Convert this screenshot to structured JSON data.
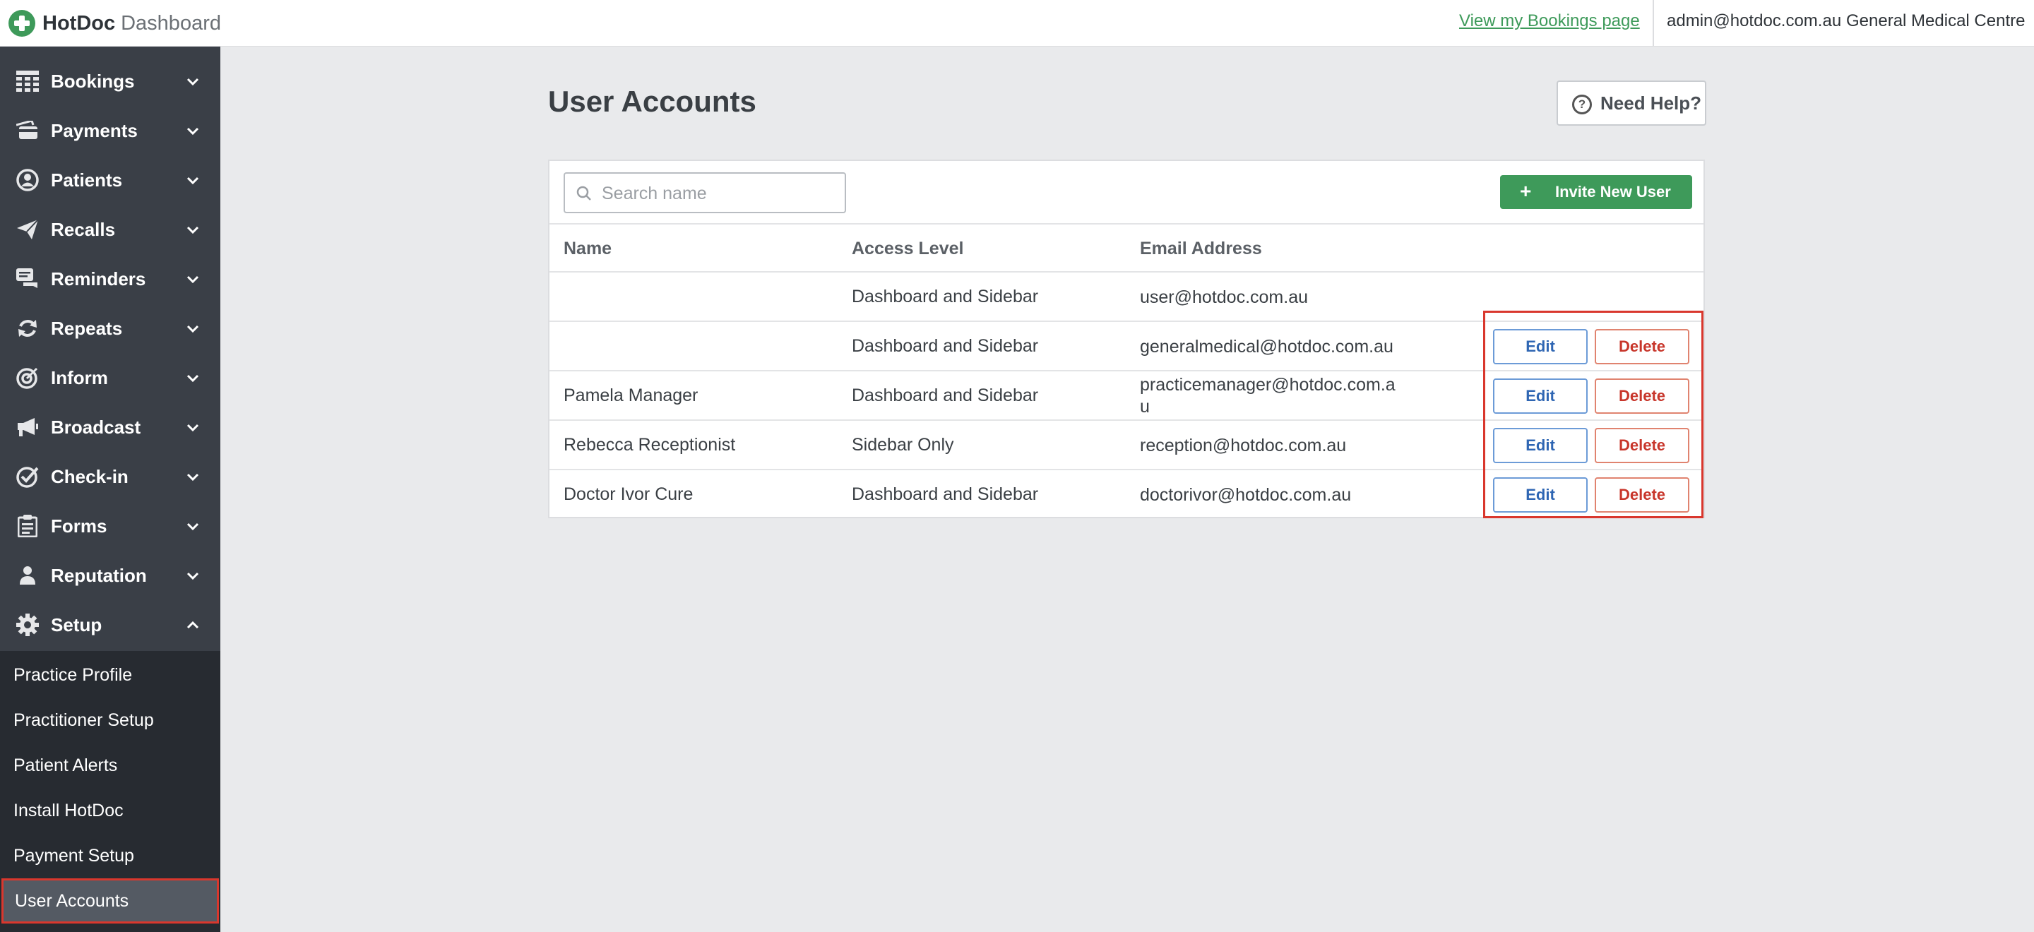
{
  "header": {
    "brand_name": "HotDoc",
    "brand_sub": "Dashboard",
    "bookings_link": "View my Bookings page",
    "user_email": "admin@hotdoc.com.au",
    "practice_name": "General Medical Centre",
    "brand_color": "#3e9a5a"
  },
  "sidebar": {
    "items": [
      {
        "label": "Bookings",
        "icon": "calendar-grid-icon"
      },
      {
        "label": "Payments",
        "icon": "card-icon"
      },
      {
        "label": "Patients",
        "icon": "user-circle-icon"
      },
      {
        "label": "Recalls",
        "icon": "paper-plane-icon"
      },
      {
        "label": "Reminders",
        "icon": "chat-icon"
      },
      {
        "label": "Repeats",
        "icon": "refresh-icon"
      },
      {
        "label": "Inform",
        "icon": "target-icon"
      },
      {
        "label": "Broadcast",
        "icon": "megaphone-icon"
      },
      {
        "label": "Check-in",
        "icon": "check-circle-icon"
      },
      {
        "label": "Forms",
        "icon": "clipboard-icon"
      },
      {
        "label": "Reputation",
        "icon": "person-icon"
      },
      {
        "label": "Setup",
        "icon": "gear-icon"
      }
    ],
    "setup_submenu": [
      {
        "label": "Practice Profile"
      },
      {
        "label": "Practitioner Setup"
      },
      {
        "label": "Patient Alerts"
      },
      {
        "label": "Install HotDoc"
      },
      {
        "label": "Payment Setup"
      },
      {
        "label": "User Accounts",
        "active": true
      }
    ]
  },
  "main": {
    "title": "User Accounts",
    "help_label": "Need Help?",
    "search_placeholder": "Search name",
    "search_value": "",
    "invite_label": "Invite New User",
    "columns": [
      "Name",
      "Access Level",
      "Email Address"
    ],
    "edit_label": "Edit",
    "delete_label": "Delete",
    "rows": [
      {
        "name": "",
        "access": "Dashboard and Sidebar",
        "email": "user@hotdoc.com.au",
        "actions": false
      },
      {
        "name": "",
        "access": "Dashboard and Sidebar",
        "email": "generalmedical@hotdoc.com.au",
        "actions": true
      },
      {
        "name": "Pamela Manager",
        "access": "Dashboard and Sidebar",
        "email": "practicemanager@hotdoc.com.au",
        "actions": true
      },
      {
        "name": "Rebecca Receptionist",
        "access": "Sidebar Only",
        "email": "reception@hotdoc.com.au",
        "actions": true
      },
      {
        "name": "Doctor Ivor Cure",
        "access": "Dashboard and Sidebar",
        "email": "doctorivor@hotdoc.com.au",
        "actions": true
      }
    ],
    "edit_color": "#2f66b3",
    "delete_color": "#c8362b",
    "highlight_color": "#d9372d"
  }
}
